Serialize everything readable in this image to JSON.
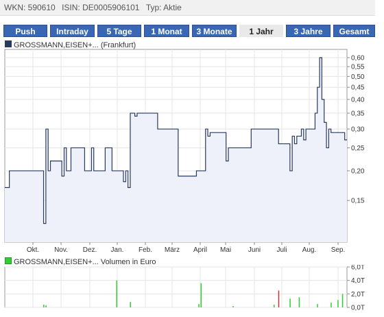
{
  "header": {
    "wkn": "WKN: 590610",
    "isin": "ISIN: DE0005906101",
    "typ": "Typ: Aktie"
  },
  "tabs": [
    {
      "label": "Push"
    },
    {
      "label": "Intraday"
    },
    {
      "label": "5 Tage"
    },
    {
      "label": "1 Monat"
    },
    {
      "label": "3 Monate"
    },
    {
      "label": "1 Jahr",
      "active": true
    },
    {
      "label": "3 Jahre"
    },
    {
      "label": "Gesamt"
    }
  ],
  "colors": {
    "tab_bg": "#3a67b4",
    "price_line": "#27395c",
    "price_fill": "#eef1fa",
    "volume_bar": "#33cc33",
    "volume_bar_alt": "#cc3333"
  },
  "chart_data": [
    {
      "type": "line",
      "legend": "GROSSMANN,EISEN+... (Frankfurt)",
      "y_scale": "log",
      "ylim": [
        0.1,
        0.65
      ],
      "y_ticks": [
        "0,60",
        "0,55",
        "0,50",
        "0,45",
        "0,40",
        "0,35",
        "0,30",
        "0,25",
        "0,20",
        "0,15"
      ],
      "y_tick_values": [
        0.6,
        0.55,
        0.5,
        0.45,
        0.4,
        0.35,
        0.3,
        0.25,
        0.2,
        0.15
      ],
      "x_ticks": [
        "Okt.",
        "Nov.",
        "Dez.",
        "Jan.",
        "Feb.",
        "März",
        "April",
        "Mai",
        "Juni",
        "Juli",
        "Aug.",
        "Sep."
      ],
      "grid": true,
      "x": [
        0,
        1,
        2,
        3,
        4,
        5,
        6,
        7,
        8,
        9,
        10,
        11,
        12,
        13,
        14,
        15,
        16,
        17,
        18,
        19,
        20,
        21,
        22,
        23,
        24,
        25,
        26,
        27,
        28,
        29,
        30,
        31,
        32,
        33,
        34,
        35,
        36,
        37,
        38,
        39,
        40,
        41,
        42,
        43,
        44,
        45,
        46,
        47,
        48,
        49,
        50,
        51,
        52,
        53,
        54,
        55,
        56,
        57,
        58,
        59,
        60,
        61,
        62,
        63,
        64,
        65,
        66,
        67,
        68,
        69,
        70,
        71,
        72,
        73,
        74,
        75,
        76,
        77,
        78,
        79,
        80,
        81,
        82,
        83,
        84,
        85,
        86,
        87,
        88,
        89,
        90,
        91,
        92,
        93,
        94,
        95,
        96,
        97,
        98,
        99,
        100,
        101,
        102,
        103,
        104,
        105,
        106,
        107,
        108,
        109,
        110,
        111,
        112,
        113,
        114,
        115,
        116,
        117,
        118,
        119,
        120,
        121,
        122,
        123,
        124,
        125,
        126,
        127,
        128,
        129,
        130,
        131,
        132,
        133,
        134,
        135,
        136,
        137,
        138,
        139,
        140,
        141,
        142,
        143,
        144,
        145,
        146,
        147,
        148,
        149,
        150
      ],
      "values": [
        0.17,
        0.17,
        0.2,
        0.2,
        0.2,
        0.2,
        0.2,
        0.2,
        0.2,
        0.2,
        0.2,
        0.2,
        0.2,
        0.2,
        0.2,
        0.2,
        0.2,
        0.12,
        0.3,
        0.2,
        0.22,
        0.22,
        0.22,
        0.22,
        0.22,
        0.19,
        0.25,
        0.2,
        0.2,
        0.25,
        0.25,
        0.25,
        0.25,
        0.25,
        0.25,
        0.2,
        0.2,
        0.2,
        0.25,
        0.2,
        0.2,
        0.2,
        0.2,
        0.2,
        0.25,
        0.25,
        0.25,
        0.2,
        0.2,
        0.2,
        0.2,
        0.2,
        0.18,
        0.2,
        0.17,
        0.35,
        0.35,
        0.34,
        0.35,
        0.35,
        0.35,
        0.35,
        0.35,
        0.35,
        0.35,
        0.35,
        0.35,
        0.3,
        0.3,
        0.3,
        0.3,
        0.3,
        0.3,
        0.3,
        0.3,
        0.3,
        0.19,
        0.19,
        0.19,
        0.19,
        0.19,
        0.19,
        0.19,
        0.19,
        0.2,
        0.2,
        0.2,
        0.2,
        0.3,
        0.28,
        0.29,
        0.29,
        0.29,
        0.29,
        0.29,
        0.29,
        0.29,
        0.22,
        0.25,
        0.25,
        0.25,
        0.25,
        0.25,
        0.25,
        0.25,
        0.25,
        0.25,
        0.25,
        0.3,
        0.3,
        0.3,
        0.3,
        0.3,
        0.3,
        0.3,
        0.3,
        0.3,
        0.3,
        0.3,
        0.3,
        0.26,
        0.26,
        0.26,
        0.26,
        0.26,
        0.2,
        0.28,
        0.26,
        0.28,
        0.28,
        0.3,
        0.27,
        0.3,
        0.3,
        0.3,
        0.3,
        0.35,
        0.45,
        0.6,
        0.4,
        0.32,
        0.25,
        0.3,
        0.29,
        0.29,
        0.29,
        0.29,
        0.29,
        0.29,
        0.27,
        0.27,
        0.27,
        0.32
      ]
    },
    {
      "type": "bar",
      "legend": "GROSSMANN,EISEN+... Volumen in Euro",
      "ylim": [
        0,
        6
      ],
      "y_ticks": [
        "6,0T",
        "4,0T",
        "2,0T",
        "0,0T"
      ],
      "y_tick_values": [
        6,
        4,
        2,
        0
      ],
      "bars": [
        {
          "x": 17,
          "value": 0.4
        },
        {
          "x": 18,
          "value": 0.3
        },
        {
          "x": 49,
          "value": 4.0
        },
        {
          "x": 55,
          "value": 0.8
        },
        {
          "x": 85,
          "value": 0.5
        },
        {
          "x": 86,
          "value": 3.6
        },
        {
          "x": 100,
          "value": 0.2
        },
        {
          "x": 118,
          "value": 0.4
        },
        {
          "x": 120,
          "value": 2.5,
          "alt": true
        },
        {
          "x": 125,
          "value": 1.3
        },
        {
          "x": 129,
          "value": 1.5
        },
        {
          "x": 137,
          "value": 0.5
        },
        {
          "x": 143,
          "value": 0.7
        },
        {
          "x": 146,
          "value": 1.1
        },
        {
          "x": 148,
          "value": 2.0
        }
      ]
    }
  ]
}
